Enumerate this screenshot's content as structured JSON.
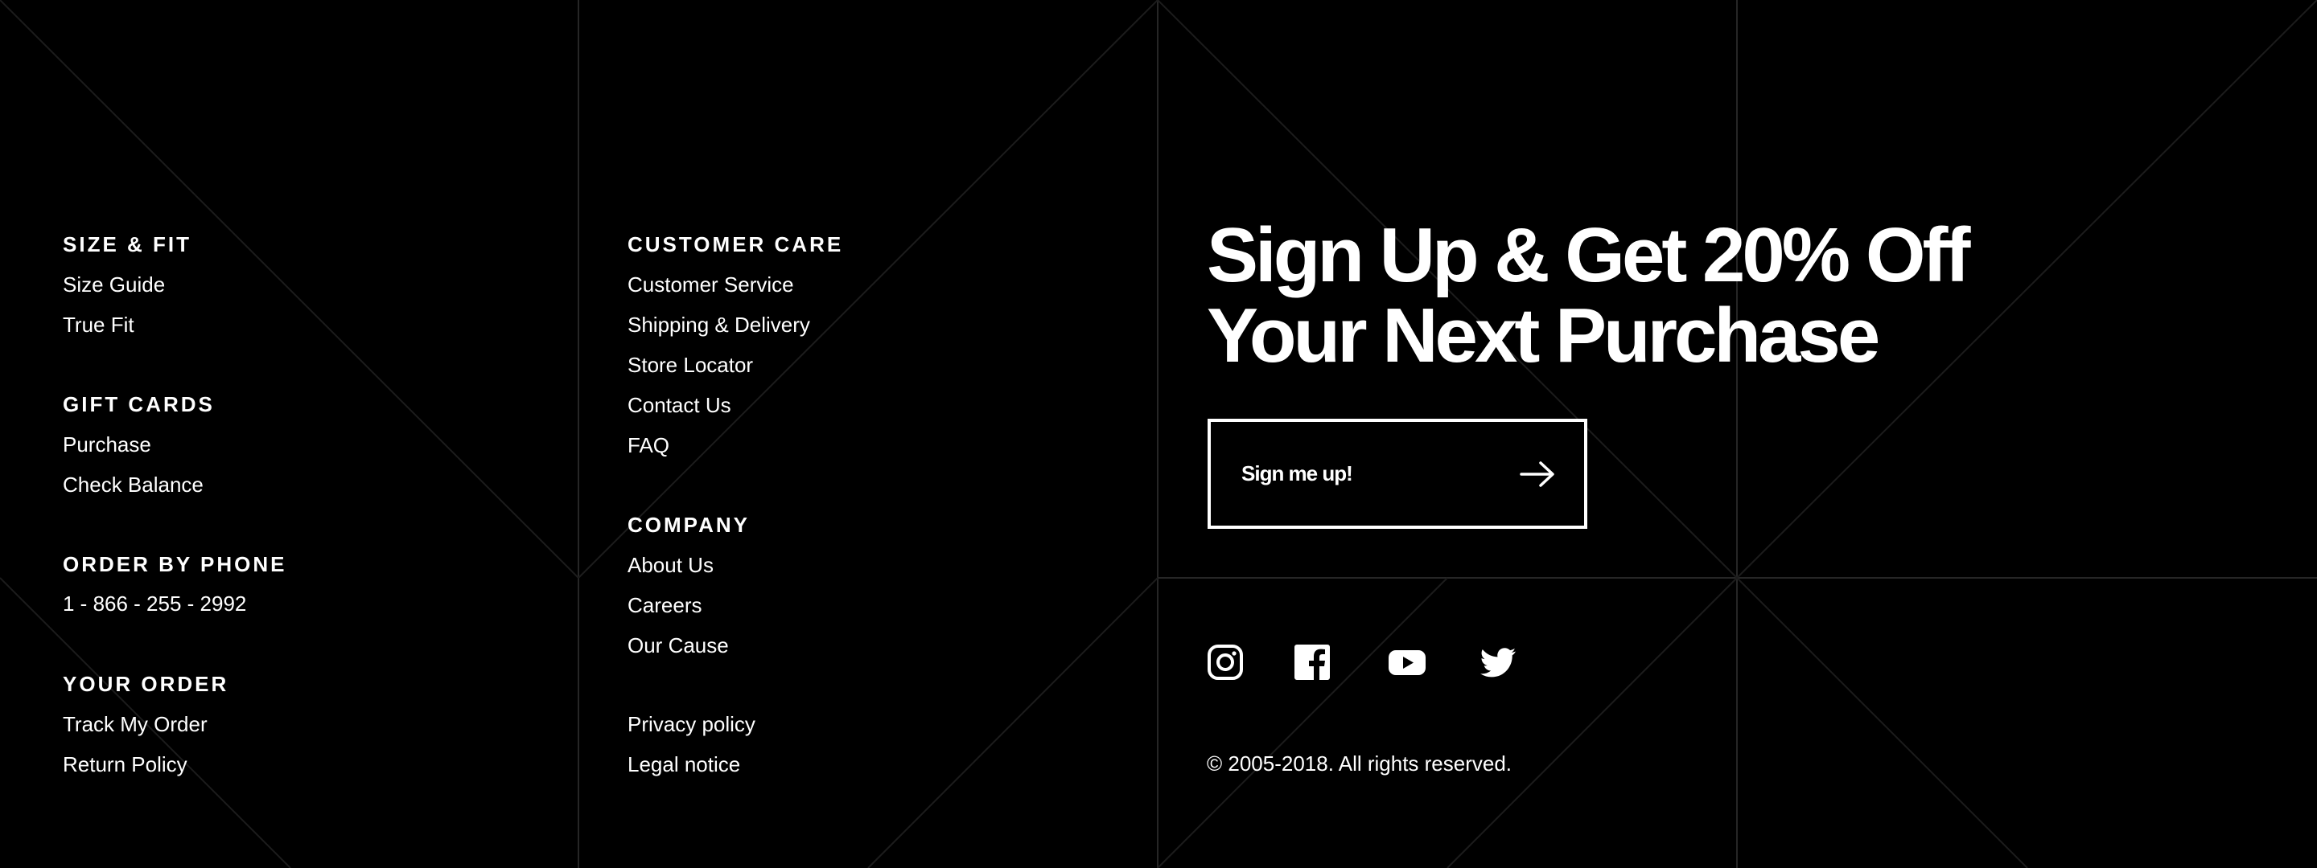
{
  "colors": {
    "background": "#000000",
    "text": "#ffffff",
    "grid_lines": "#262626"
  },
  "left_column": {
    "size_fit": {
      "heading": "SIZE & FIT",
      "links": [
        "Size Guide",
        "True Fit"
      ]
    },
    "gift_cards": {
      "heading": "GIFT CARDS",
      "links": [
        "Purchase",
        "Check Balance"
      ]
    },
    "order_by_phone": {
      "heading": "ORDER BY PHONE",
      "phone": "1 - 866 - 255 - 2992"
    },
    "your_order": {
      "heading": "YOUR ORDER",
      "links": [
        "Track My Order",
        "Return Policy"
      ]
    }
  },
  "middle_column": {
    "customer_care": {
      "heading": "CUSTOMER CARE",
      "links": [
        "Customer Service",
        "Shipping & Delivery",
        "Store Locator",
        "Contact Us",
        "FAQ"
      ]
    },
    "company": {
      "heading": "COMPANY",
      "links": [
        "About Us",
        "Careers",
        "Our Cause"
      ]
    },
    "legal": {
      "links": [
        "Privacy policy",
        "Legal notice"
      ]
    }
  },
  "signup": {
    "title_line1": "Sign Up & Get 20% Off",
    "title_line2": "Your Next Purchase",
    "button_label": "Sign me up!",
    "button_icon": "arrow-right-icon"
  },
  "social": {
    "icons": [
      "instagram-icon",
      "facebook-icon",
      "youtube-icon",
      "twitter-icon"
    ]
  },
  "footer": {
    "copyright": "© 2005-2018.  All rights reserved."
  }
}
